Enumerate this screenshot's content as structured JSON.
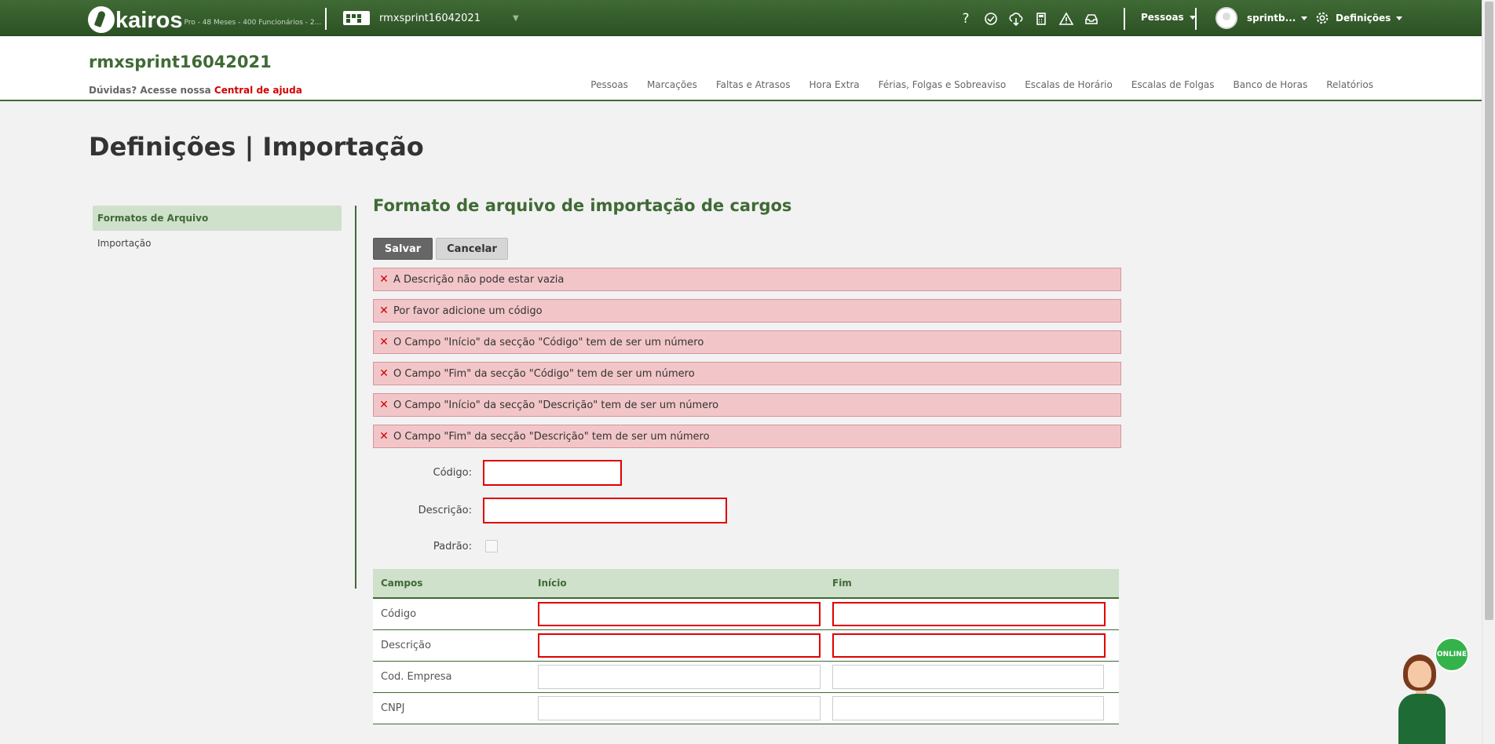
{
  "topbar": {
    "brand": "kairos",
    "plan": "Pro - 48 Meses - 400 Funcionários - 2...",
    "company_name": "rmxsprint16042021",
    "icons": [
      "help-icon",
      "support-icon",
      "cloud-download-icon",
      "calculator-icon",
      "warning-icon",
      "inbox-icon"
    ],
    "people_menu": "Pessoas",
    "user_menu": "sprintb...",
    "settings_menu": "Definições"
  },
  "header": {
    "company_title": "rmxsprint16042021",
    "help_prefix": "Dúvidas? Acesse nossa",
    "help_link": "Central de ajuda",
    "nav": [
      "Pessoas",
      "Marcações",
      "Faltas e Atrasos",
      "Hora Extra",
      "Férias, Folgas e Sobreaviso",
      "Escalas de Horário",
      "Escalas de Folgas",
      "Banco de Horas",
      "Relatórios"
    ]
  },
  "page": {
    "title": "Definições | Importação"
  },
  "sidebar": {
    "items": [
      {
        "label": "Formatos de Arquivo",
        "active": true
      },
      {
        "label": "Importação",
        "active": false
      }
    ]
  },
  "form": {
    "section_title": "Formato de arquivo de importação de cargos",
    "save_label": "Salvar",
    "cancel_label": "Cancelar",
    "errors": [
      "A Descrição não pode estar vazia",
      "Por favor adicione um código",
      "O Campo \"Início\" da secção \"Código\" tem de ser um número",
      "O Campo \"Fim\" da secção \"Código\" tem de ser um número",
      "O Campo \"Início\" da secção \"Descrição\" tem de ser um número",
      "O Campo \"Fim\" da secção \"Descrição\" tem de ser um número"
    ],
    "codigo_label": "Código:",
    "codigo_value": "",
    "descricao_label": "Descrição:",
    "descricao_value": "",
    "padrao_label": "Padrão:",
    "padrao_checked": false,
    "table": {
      "headers": [
        "Campos",
        "Início",
        "Fim"
      ],
      "rows": [
        {
          "campo": "Código",
          "inicio": "",
          "fim": "",
          "invalid": true
        },
        {
          "campo": "Descrição",
          "inicio": "",
          "fim": "",
          "invalid": true
        },
        {
          "campo": "Cod. Empresa",
          "inicio": "",
          "fim": "",
          "invalid": false
        },
        {
          "campo": "CNPJ",
          "inicio": "",
          "fim": "",
          "invalid": false
        }
      ]
    }
  },
  "chat": {
    "status": "ONLINE"
  },
  "colors": {
    "brand_green": "#3f6a35",
    "error_bg": "#f2c6c8",
    "error_red": "#e00000"
  }
}
